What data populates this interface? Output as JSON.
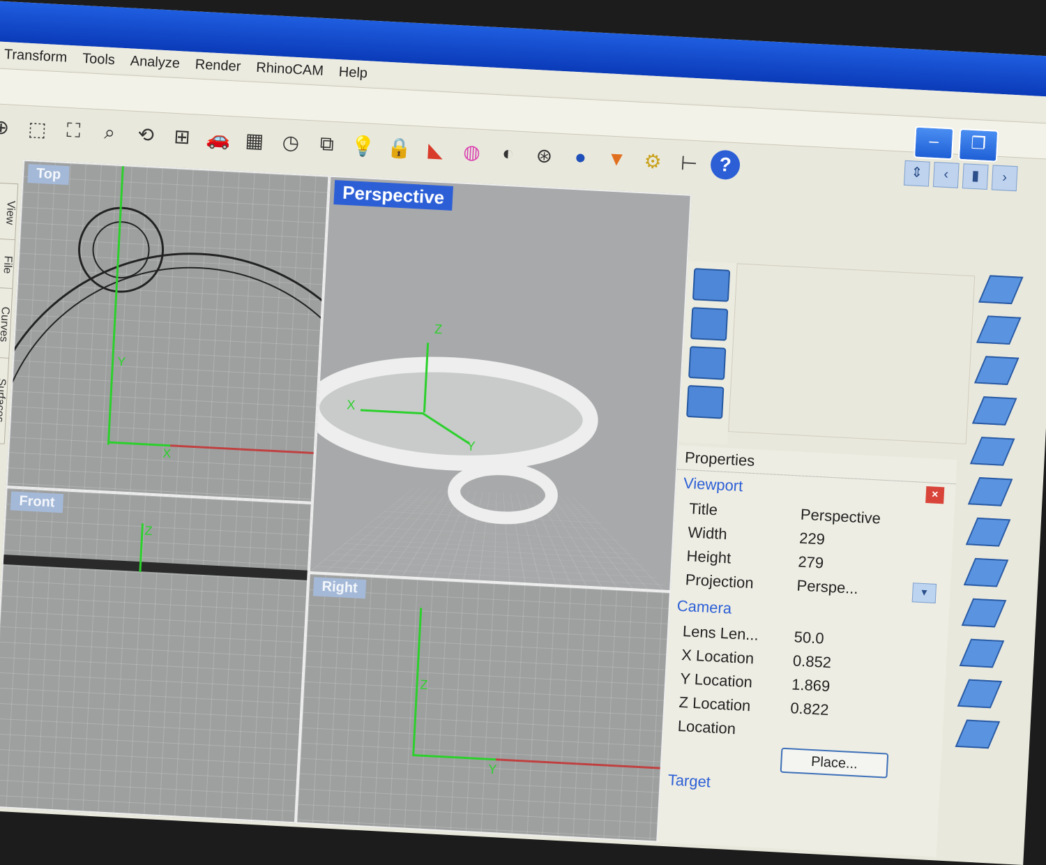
{
  "menu": [
    "Transform",
    "Tools",
    "Analyze",
    "Render",
    "RhinoCAM",
    "Help"
  ],
  "window_buttons": {
    "minimize": "–",
    "restore": "❐"
  },
  "toolbar": [
    {
      "name": "zoom-in-icon",
      "glyph": "⊕"
    },
    {
      "name": "zoom-window-icon",
      "glyph": "⬚"
    },
    {
      "name": "zoom-extents-icon",
      "glyph": "⛶"
    },
    {
      "name": "zoom-selected-icon",
      "glyph": "⌕"
    },
    {
      "name": "rotate-view-icon",
      "glyph": "⟲"
    },
    {
      "name": "four-viewports-icon",
      "glyph": "⊞"
    },
    {
      "name": "car-icon",
      "glyph": "🚗"
    },
    {
      "name": "grid-icon",
      "glyph": "▦"
    },
    {
      "name": "clock-icon",
      "glyph": "◷"
    },
    {
      "name": "group-icon",
      "glyph": "⧉"
    },
    {
      "name": "lightbulb-icon",
      "glyph": "💡"
    },
    {
      "name": "lock-icon",
      "glyph": "🔒"
    },
    {
      "name": "shaded-surface-icon",
      "glyph": "◣"
    },
    {
      "name": "color-wheel-icon",
      "glyph": "◍"
    },
    {
      "name": "sphere-wireframe-icon",
      "glyph": "◐"
    },
    {
      "name": "sphere-grid-icon",
      "glyph": "⊛"
    },
    {
      "name": "rendered-sphere-icon",
      "glyph": "●"
    },
    {
      "name": "render-icon",
      "glyph": "▼"
    },
    {
      "name": "gear-icon",
      "glyph": "⚙"
    },
    {
      "name": "dimension-icon",
      "glyph": "⊢"
    },
    {
      "name": "help-icon",
      "glyph": "?"
    }
  ],
  "nav_arrows": [
    "⇕",
    "‹",
    "▮",
    "›"
  ],
  "left_tabs": [
    "View",
    "File",
    "Curves",
    "Surfaces"
  ],
  "viewports": {
    "top": "Top",
    "perspective": "Perspective",
    "front": "Front",
    "right": "Right"
  },
  "axis_labels": {
    "x": "x",
    "y": "y",
    "z": "z",
    "X": "X",
    "Y": "Y",
    "Z": "Z"
  },
  "properties": {
    "header": "Properties",
    "close": "×",
    "viewport_section": "Viewport",
    "title_key": "Title",
    "title_val": "Perspective",
    "width_key": "Width",
    "width_val": "229",
    "height_key": "Height",
    "height_val": "279",
    "projection_key": "Projection",
    "projection_val": "Perspe...",
    "camera_section": "Camera",
    "lens_key": "Lens Len...",
    "lens_val": "50.0",
    "xloc_key": "X Location",
    "xloc_val": "0.852",
    "yloc_key": "Y Location",
    "yloc_val": "1.869",
    "zloc_key": "Z Location",
    "zloc_val": "0.822",
    "loc_key": "Location",
    "place_btn": "Place...",
    "target_section": "Target"
  },
  "colors": {
    "titlebar": "#1f5ee0",
    "active_viewport": "#2c5fd6",
    "axis_green": "#2bd02b",
    "axis_red": "#c04040"
  }
}
